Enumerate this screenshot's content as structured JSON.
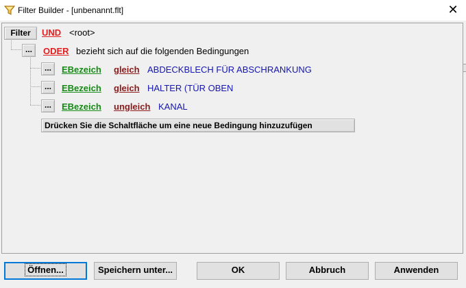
{
  "window": {
    "title": "Filter Builder - [unbenannt.flt]",
    "app_icon": "filter-funnel-icon",
    "close_glyph": "✕"
  },
  "filter": {
    "button_label": "Filter",
    "root_operator": "UND",
    "root_label": "<root>",
    "group": {
      "button_label": "...",
      "operator": "ODER",
      "description": "bezieht sich auf die folgenden Bedingungen"
    },
    "conditions": [
      {
        "button_label": "...",
        "field": "EBezeich",
        "operator": "gleich",
        "value": "ABDECKBLECH FÜR ABSCHRANKUNG"
      },
      {
        "button_label": "...",
        "field": "EBezeich",
        "operator": "gleich",
        "value": "HALTER (TÜR OBEN"
      },
      {
        "button_label": "...",
        "field": "EBezeich",
        "operator": "ungleich",
        "value": "KANAL"
      }
    ],
    "add_condition_label": "Drücken Sie die Schaltfläche um eine neue Bedingung hinzuzufügen"
  },
  "buttons": {
    "open": "Öffnen...",
    "save_as": "Speichern unter...",
    "ok": "OK",
    "cancel": "Abbruch",
    "apply": "Anwenden"
  },
  "colors": {
    "operator_link": "#e02020",
    "field_link": "#138a13",
    "condition_operator": "#8b1a1a",
    "value_text": "#1515b0",
    "focus_border": "#0078d7"
  }
}
